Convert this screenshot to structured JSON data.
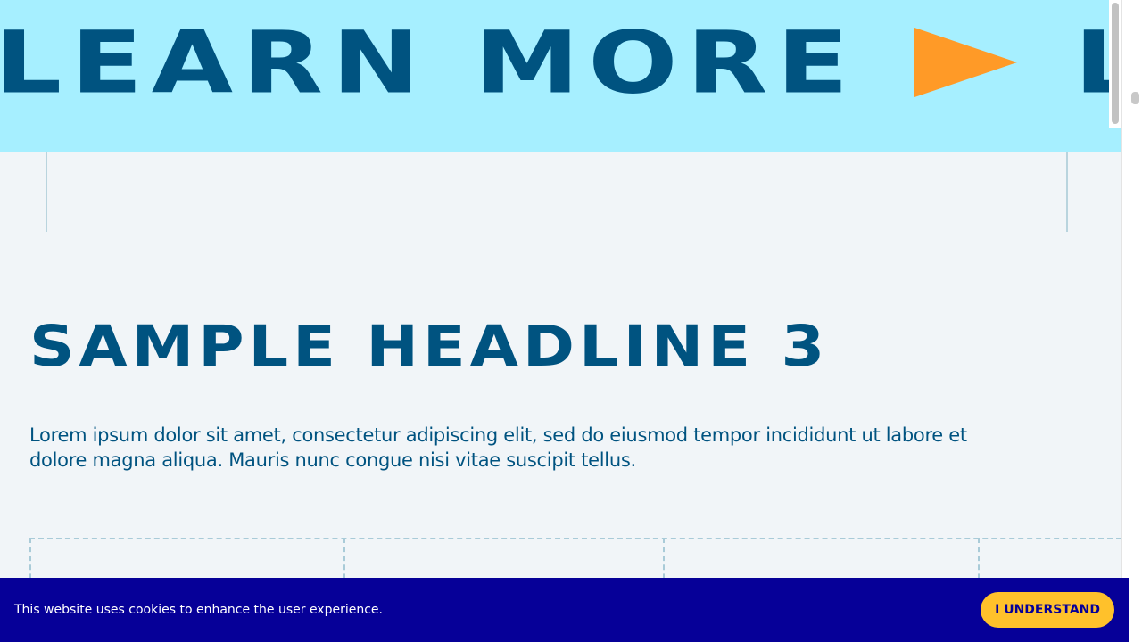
{
  "marquee": {
    "text_1": "LEARN MORE",
    "text_2": "LEARN MORE",
    "arrow_icon": "arrow-right-triangle-icon",
    "arrow_color": "#ff9a27",
    "background_color": "#a6efff",
    "text_color": "#005380"
  },
  "section": {
    "headline": "SAMPLE HEADLINE 3",
    "body": "Lorem ipsum dolor sit amet, consectetur adipiscing elit, sed do eiusmod tempor incididunt ut labore et dolore magna aliqua. Mauris nunc congue nisi vitae suscipit tellus."
  },
  "cookie_banner": {
    "message": "This website uses cookies to enhance the user experience.",
    "accept_label": "I UNDERSTAND",
    "background_color": "#060098",
    "button_color": "#ffc12b"
  }
}
